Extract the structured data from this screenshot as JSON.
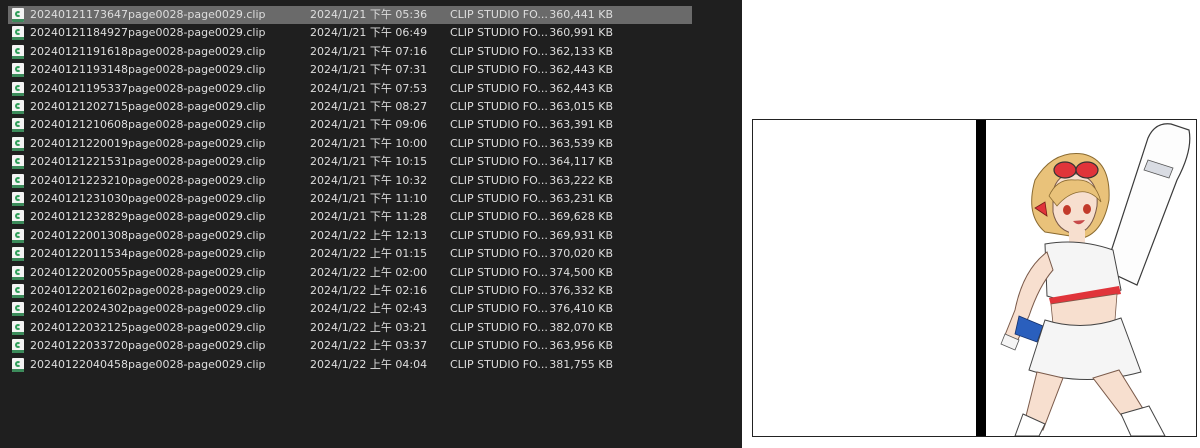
{
  "explorer": {
    "files": [
      {
        "name": "20240121173647page0028-page0029.clip",
        "date": "2024/1/21 下午 05:36",
        "type": "CLIP STUDIO FO...",
        "size": "360,441 KB",
        "selected": true
      },
      {
        "name": "20240121184927page0028-page0029.clip",
        "date": "2024/1/21 下午 06:49",
        "type": "CLIP STUDIO FO...",
        "size": "360,991 KB"
      },
      {
        "name": "20240121191618page0028-page0029.clip",
        "date": "2024/1/21 下午 07:16",
        "type": "CLIP STUDIO FO...",
        "size": "362,133 KB"
      },
      {
        "name": "20240121193148page0028-page0029.clip",
        "date": "2024/1/21 下午 07:31",
        "type": "CLIP STUDIO FO...",
        "size": "362,443 KB"
      },
      {
        "name": "20240121195337page0028-page0029.clip",
        "date": "2024/1/21 下午 07:53",
        "type": "CLIP STUDIO FO...",
        "size": "362,443 KB"
      },
      {
        "name": "20240121202715page0028-page0029.clip",
        "date": "2024/1/21 下午 08:27",
        "type": "CLIP STUDIO FO...",
        "size": "363,015 KB"
      },
      {
        "name": "20240121210608page0028-page0029.clip",
        "date": "2024/1/21 下午 09:06",
        "type": "CLIP STUDIO FO...",
        "size": "363,391 KB"
      },
      {
        "name": "20240121220019page0028-page0029.clip",
        "date": "2024/1/21 下午 10:00",
        "type": "CLIP STUDIO FO...",
        "size": "363,539 KB"
      },
      {
        "name": "20240121221531page0028-page0029.clip",
        "date": "2024/1/21 下午 10:15",
        "type": "CLIP STUDIO FO...",
        "size": "364,117 KB"
      },
      {
        "name": "20240121223210page0028-page0029.clip",
        "date": "2024/1/21 下午 10:32",
        "type": "CLIP STUDIO FO...",
        "size": "363,222 KB"
      },
      {
        "name": "20240121231030page0028-page0029.clip",
        "date": "2024/1/21 下午 11:10",
        "type": "CLIP STUDIO FO...",
        "size": "363,231 KB"
      },
      {
        "name": "20240121232829page0028-page0029.clip",
        "date": "2024/1/21 下午 11:28",
        "type": "CLIP STUDIO FO...",
        "size": "369,628 KB"
      },
      {
        "name": "20240122001308page0028-page0029.clip",
        "date": "2024/1/22 上午 12:13",
        "type": "CLIP STUDIO FO...",
        "size": "369,931 KB"
      },
      {
        "name": "20240122011534page0028-page0029.clip",
        "date": "2024/1/22 上午 01:15",
        "type": "CLIP STUDIO FO...",
        "size": "370,020 KB"
      },
      {
        "name": "20240122020055page0028-page0029.clip",
        "date": "2024/1/22 上午 02:00",
        "type": "CLIP STUDIO FO...",
        "size": "374,500 KB"
      },
      {
        "name": "20240122021602page0028-page0029.clip",
        "date": "2024/1/22 上午 02:16",
        "type": "CLIP STUDIO FO...",
        "size": "376,332 KB"
      },
      {
        "name": "20240122024302page0028-page0029.clip",
        "date": "2024/1/22 上午 02:43",
        "type": "CLIP STUDIO FO...",
        "size": "376,410 KB"
      },
      {
        "name": "20240122032125page0028-page0029.clip",
        "date": "2024/1/22 上午 03:21",
        "type": "CLIP STUDIO FO...",
        "size": "382,070 KB"
      },
      {
        "name": "20240122033720page0028-page0029.clip",
        "date": "2024/1/22 上午 03:37",
        "type": "CLIP STUDIO FO...",
        "size": "363,956 KB"
      },
      {
        "name": "20240122040458page0028-page0029.clip",
        "date": "2024/1/22 上午 04:04",
        "type": "CLIP STUDIO FO...",
        "size": "381,755 KB"
      }
    ]
  },
  "preview": {
    "icon": "illustration-preview-image",
    "colors": {
      "skin": "#f7dfcf",
      "hair": "#e9c27a",
      "outfit": "#f5f5f5",
      "accent_red": "#e0343a",
      "accent_blue": "#2a5fbd",
      "stockings": "#ffffff"
    }
  }
}
